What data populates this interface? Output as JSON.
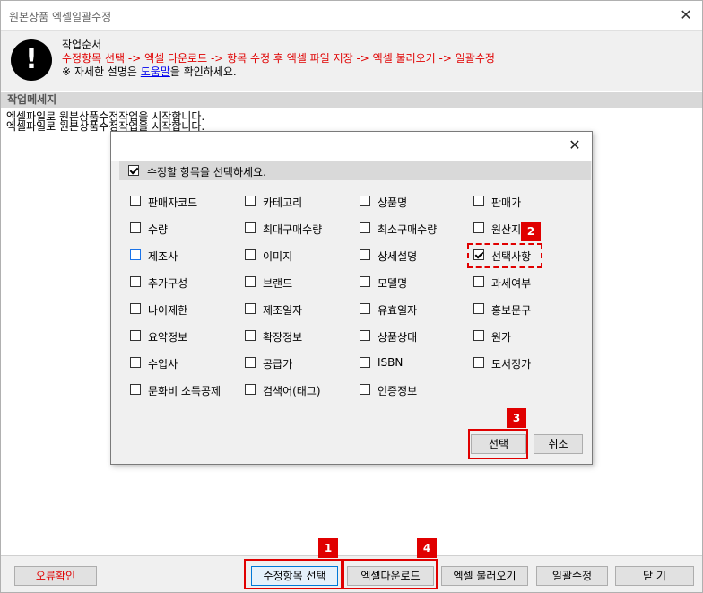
{
  "window": {
    "title": "원본상품 엑셀일괄수정",
    "close_glyph": "✕"
  },
  "info": {
    "icon_glyph": "!",
    "heading": "작업순서",
    "order": "수정항목 선택 -> 엑셀 다운로드 -> 항목 수정 후 엑셀 파일 저장 -> 엑셀 불러오기 -> 일괄수정",
    "help_prefix": "※ 자세한 설명은 ",
    "help_link": "도움말",
    "help_suffix": "을 확인하세요."
  },
  "messages": {
    "header": "작업메세지",
    "lines": [
      "엑셀파일로 원본상품수정작업을 시작합니다.",
      "엑셀파일로 원본상품수정작업을 시작합니다."
    ]
  },
  "dialog": {
    "close_glyph": "✕",
    "select_all_label": "수정할 항목을 선택하세요.",
    "select_all_checked": true,
    "items": [
      {
        "label": "판매자코드",
        "checked": false
      },
      {
        "label": "카테고리",
        "checked": false
      },
      {
        "label": "상품명",
        "checked": false
      },
      {
        "label": "판매가",
        "checked": false
      },
      {
        "label": "수량",
        "checked": false
      },
      {
        "label": "최대구매수량",
        "checked": false
      },
      {
        "label": "최소구매수량",
        "checked": false
      },
      {
        "label": "원산지",
        "checked": false
      },
      {
        "label": "제조사",
        "checked": false
      },
      {
        "label": "이미지",
        "checked": false
      },
      {
        "label": "상세설명",
        "checked": false
      },
      {
        "label": "선택사항",
        "checked": true
      },
      {
        "label": "추가구성",
        "checked": false
      },
      {
        "label": "브랜드",
        "checked": false
      },
      {
        "label": "모델명",
        "checked": false
      },
      {
        "label": "과세여부",
        "checked": false
      },
      {
        "label": "나이제한",
        "checked": false
      },
      {
        "label": "제조일자",
        "checked": false
      },
      {
        "label": "유효일자",
        "checked": false
      },
      {
        "label": "홍보문구",
        "checked": false
      },
      {
        "label": "요약정보",
        "checked": false
      },
      {
        "label": "확장정보",
        "checked": false
      },
      {
        "label": "상품상태",
        "checked": false
      },
      {
        "label": "원가",
        "checked": false
      },
      {
        "label": "수입사",
        "checked": false
      },
      {
        "label": "공급가",
        "checked": false
      },
      {
        "label": "ISBN",
        "checked": false
      },
      {
        "label": "도서정가",
        "checked": false
      },
      {
        "label": "문화비 소득공제",
        "checked": false
      },
      {
        "label": "검색어(태그)",
        "checked": false
      },
      {
        "label": "인증정보",
        "checked": false
      }
    ],
    "ok_label": "선택",
    "cancel_label": "취소"
  },
  "bottom": {
    "error_check": "오류확인",
    "select_items": "수정항목 선택",
    "excel_download": "엑셀다운로드",
    "excel_load": "엑셀 불러오기",
    "batch_edit": "일괄수정",
    "close": "닫 기"
  },
  "callouts": {
    "badge1": "1",
    "badge2": "2",
    "badge3": "3",
    "badge4": "4"
  },
  "colors": {
    "callout": "#e00000",
    "order_text": "#e00000",
    "link": "#0000ee"
  }
}
